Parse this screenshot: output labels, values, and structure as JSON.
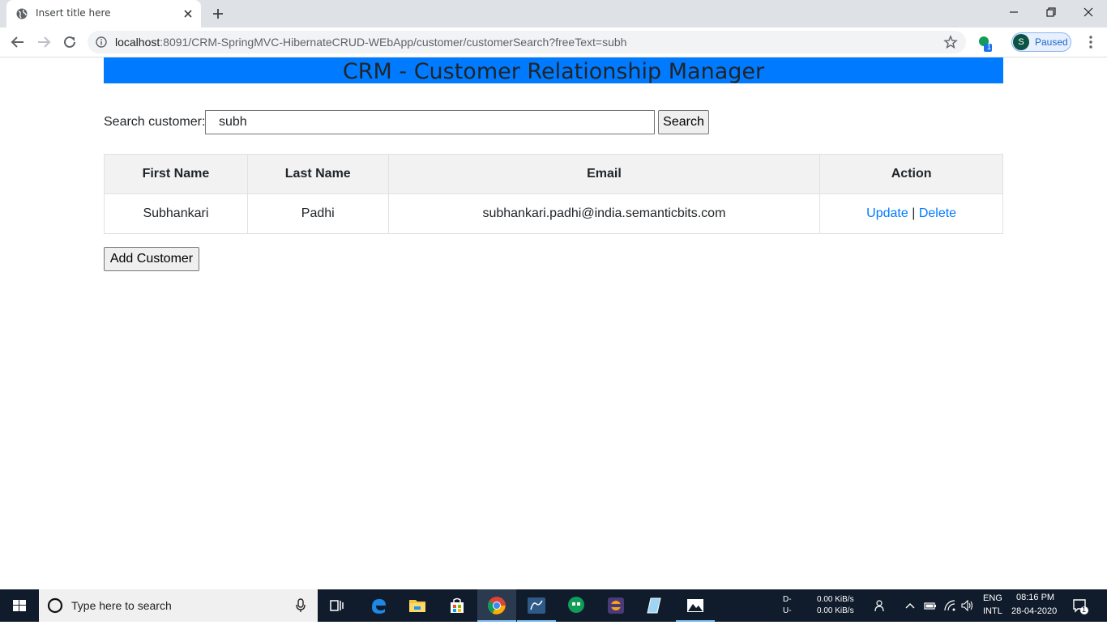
{
  "browser": {
    "tab_title": "Insert title here",
    "url_host": "localhost",
    "url_rest": ":8091/CRM-SpringMVC-HibernateCRUD-WEbApp/customer/customerSearch?freeText=subh",
    "profile_initial": "S",
    "profile_status": "Paused",
    "extension_badge": "1"
  },
  "page": {
    "header_title": "CRM - Customer Relationship Manager",
    "search_label": "Search customer:",
    "search_value": "subh",
    "search_button": "Search",
    "add_button": "Add Customer",
    "table": {
      "columns": [
        "First Name",
        "Last Name",
        "Email",
        "Action"
      ],
      "rows": [
        {
          "first_name": "Subhankari",
          "last_name": "Padhi",
          "email": "subhankari.padhi@india.semanticbits.com",
          "update_label": "Update",
          "separator": "|",
          "delete_label": "Delete"
        }
      ]
    }
  },
  "taskbar": {
    "search_placeholder": "Type here to search",
    "net_down_label": "D-",
    "net_up_label": "U-",
    "net_down_rate": "0.00 KiB/s",
    "net_up_rate": "0.00 KiB/s",
    "lang_top": "ENG",
    "lang_bottom": "INTL",
    "time": "08:16 PM",
    "date": "28-04-2020",
    "notification_count": "1"
  },
  "colors": {
    "header_bar": "#007bff",
    "link": "#007bff",
    "taskbar": "#101c2c"
  }
}
